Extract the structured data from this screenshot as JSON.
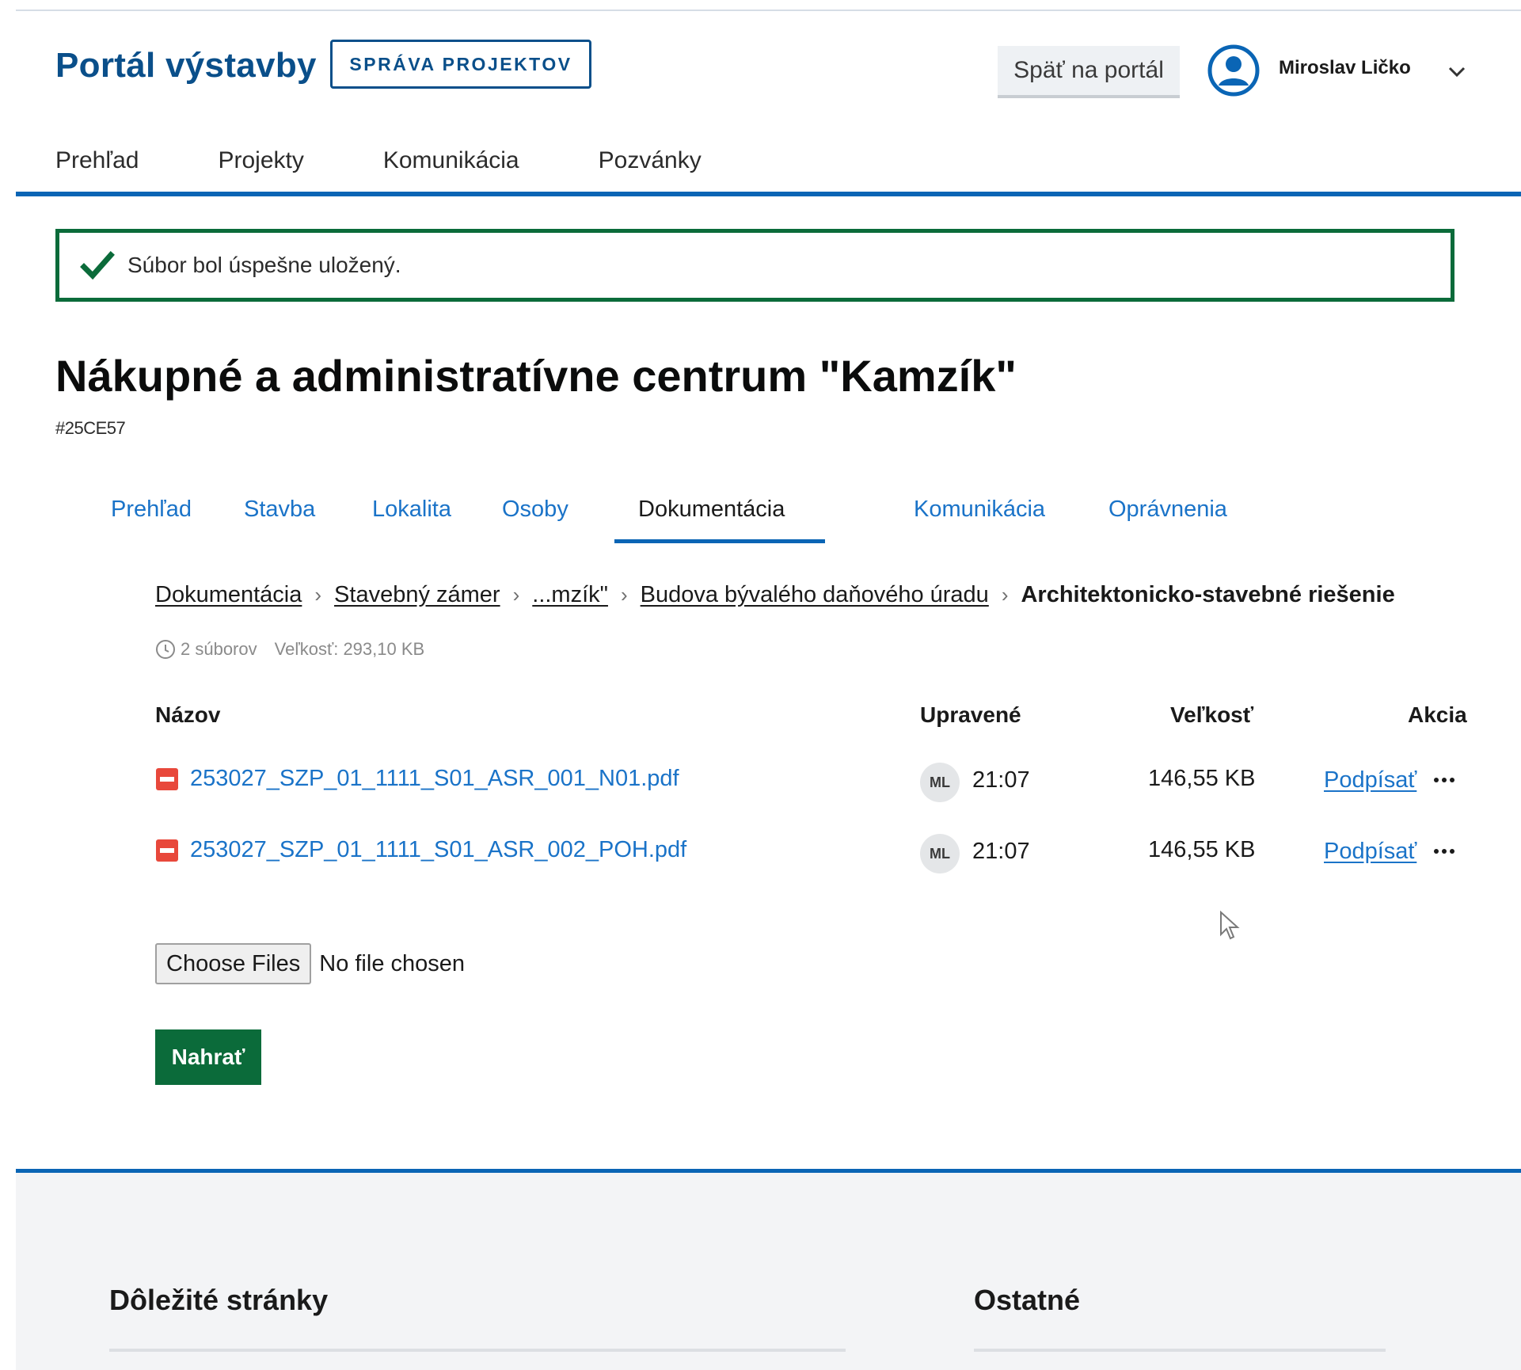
{
  "header": {
    "brand": "Portál výstavby",
    "badge": "SPRÁVA PROJEKTOV",
    "back_button": "Späť na portál",
    "user_name": "Miroslav Ličko"
  },
  "nav": {
    "items": [
      "Prehľad",
      "Projekty",
      "Komunikácia",
      "Pozvánky"
    ]
  },
  "alert": {
    "message": "Súbor bol úspešne uložený."
  },
  "project": {
    "title": "Nákupné a administratívne centrum \"Kamzík\"",
    "id": "#25CE57"
  },
  "tabs": {
    "items": [
      "Prehľad",
      "Stavba",
      "Lokalita",
      "Osoby",
      "Dokumentácia",
      "Komunikácia",
      "Oprávnenia"
    ],
    "active": "Dokumentácia"
  },
  "breadcrumb": {
    "items": [
      "Dokumentácia",
      "Stavebný zámer",
      "...mzík\"",
      "Budova bývalého daňového úradu"
    ],
    "current": "Architektonicko-stavebné riešenie"
  },
  "meta": {
    "count": "2 súborov",
    "size": "Veľkosť: 293,10 KB"
  },
  "table": {
    "headers": {
      "name": "Názov",
      "modified": "Upravené",
      "size": "Veľkosť",
      "action": "Akcia"
    },
    "rows": [
      {
        "name": "253027_SZP_01_1111_S01_ASR_001_N01.pdf",
        "avatar": "ML",
        "time": "21:07",
        "size": "146,55 KB",
        "action": "Podpísať"
      },
      {
        "name": "253027_SZP_01_1111_S01_ASR_002_POH.pdf",
        "avatar": "ML",
        "time": "21:07",
        "size": "146,55 KB",
        "action": "Podpísať"
      }
    ]
  },
  "upload": {
    "choose_label": "Choose Files",
    "no_file": "No file chosen",
    "submit_label": "Nahrať"
  },
  "footer": {
    "col1_title": "Dôležité stránky",
    "col2_title": "Ostatné"
  },
  "colors": {
    "brand": "#0a4f8a",
    "accent": "#0a65b5",
    "link": "#1a73c8",
    "success": "#0b6b3a",
    "pdf_icon": "#e8483b"
  }
}
